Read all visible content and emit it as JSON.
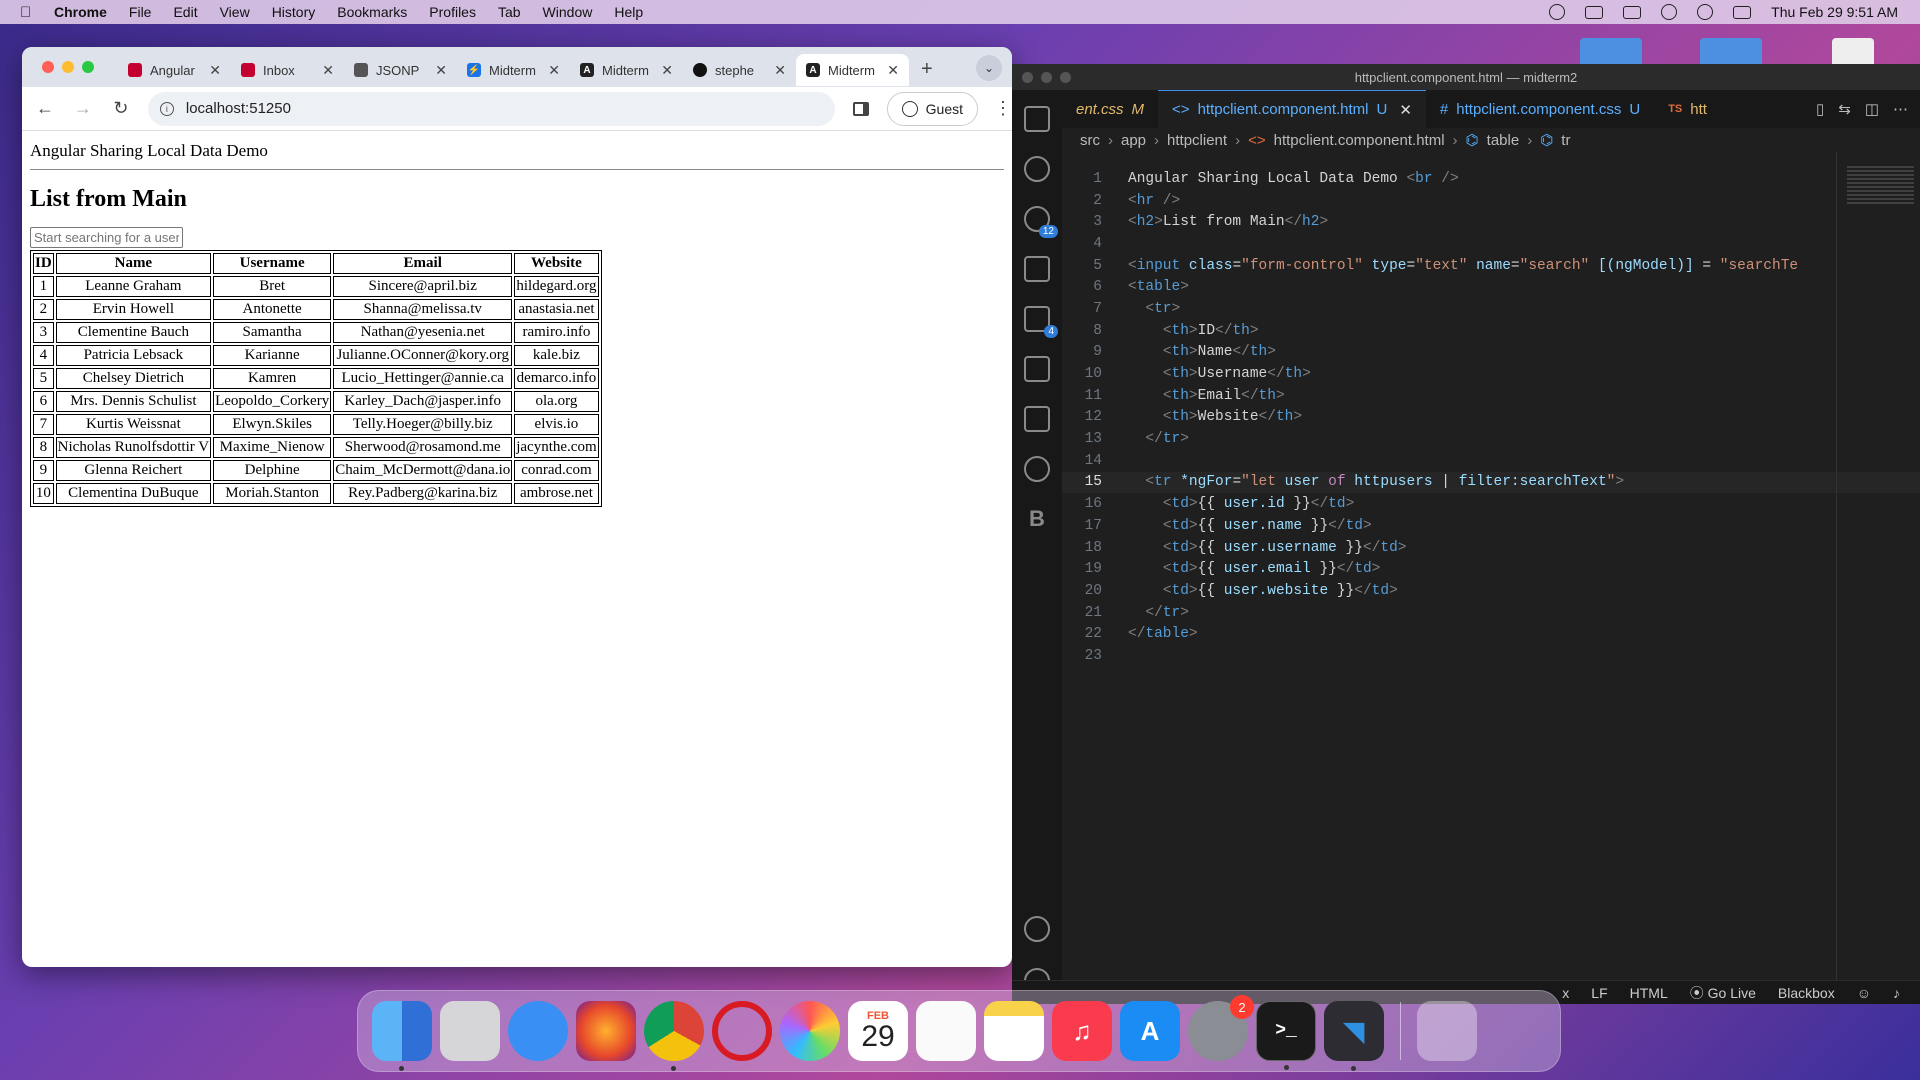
{
  "menubar": {
    "app": "Chrome",
    "items": [
      "File",
      "Edit",
      "View",
      "History",
      "Bookmarks",
      "Profiles",
      "Tab",
      "Window",
      "Help"
    ],
    "clock": "Thu Feb 29  9:51 AM"
  },
  "chrome": {
    "tabs": [
      {
        "label": "Angular",
        "favicon_color": "#c3002f"
      },
      {
        "label": "Inbox",
        "favicon_color": "#c3002f"
      },
      {
        "label": "JSONP",
        "favicon_color": "#555555"
      },
      {
        "label": "Midterm",
        "favicon_color": "#1a73e8"
      },
      {
        "label": "Midterm",
        "favicon_color": "#222222"
      },
      {
        "label": "stephe",
        "favicon_color": "#111111"
      },
      {
        "label": "Midterm",
        "favicon_color": "#222222"
      }
    ],
    "url": "localhost:51250",
    "guest_label": "Guest"
  },
  "page": {
    "demo_title": "Angular Sharing Local Data Demo",
    "heading": "List from Main",
    "search_placeholder": "Start searching for a user",
    "columns": [
      "ID",
      "Name",
      "Username",
      "Email",
      "Website"
    ],
    "rows": [
      [
        "1",
        "Leanne Graham",
        "Bret",
        "Sincere@april.biz",
        "hildegard.org"
      ],
      [
        "2",
        "Ervin Howell",
        "Antonette",
        "Shanna@melissa.tv",
        "anastasia.net"
      ],
      [
        "3",
        "Clementine Bauch",
        "Samantha",
        "Nathan@yesenia.net",
        "ramiro.info"
      ],
      [
        "4",
        "Patricia Lebsack",
        "Karianne",
        "Julianne.OConner@kory.org",
        "kale.biz"
      ],
      [
        "5",
        "Chelsey Dietrich",
        "Kamren",
        "Lucio_Hettinger@annie.ca",
        "demarco.info"
      ],
      [
        "6",
        "Mrs. Dennis Schulist",
        "Leopoldo_Corkery",
        "Karley_Dach@jasper.info",
        "ola.org"
      ],
      [
        "7",
        "Kurtis Weissnat",
        "Elwyn.Skiles",
        "Telly.Hoeger@billy.biz",
        "elvis.io"
      ],
      [
        "8",
        "Nicholas Runolfsdottir V",
        "Maxime_Nienow",
        "Sherwood@rosamond.me",
        "jacynthe.com"
      ],
      [
        "9",
        "Glenna Reichert",
        "Delphine",
        "Chaim_McDermott@dana.io",
        "conrad.com"
      ],
      [
        "10",
        "Clementina DuBuque",
        "Moriah.Stanton",
        "Rey.Padberg@karina.biz",
        "ambrose.net"
      ]
    ]
  },
  "vscode": {
    "title": "httpclient.component.html — midterm2",
    "tabs": [
      {
        "label": "ent.css",
        "mod": "M",
        "icon": "",
        "italic": true
      },
      {
        "label": "httpclient.component.html",
        "mod": "U",
        "icon": "<>",
        "active": true
      },
      {
        "label": "httpclient.component.css",
        "mod": "U",
        "icon": "#"
      },
      {
        "label": "htt",
        "mod": "",
        "icon": "TS"
      }
    ],
    "breadcrumb": [
      "src",
      "app",
      "httpclient",
      "httpclient.component.html",
      "table",
      "tr"
    ],
    "activity_badges": {
      "source_control": "12",
      "extensions": "4"
    },
    "current_line": 15,
    "status": {
      "eol": "LF",
      "language": "HTML",
      "golive": "Go Live",
      "blackbox": "Blackbox",
      "left_fragment": "x"
    }
  },
  "dock": {
    "calendar_month": "FEB",
    "calendar_day": "29",
    "settings_badge": "2"
  }
}
